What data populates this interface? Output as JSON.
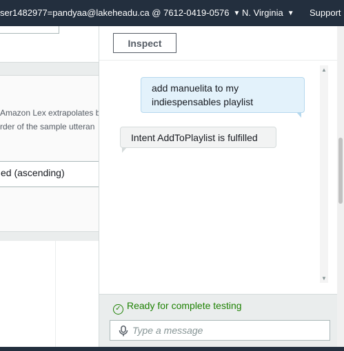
{
  "nav": {
    "account": "ser1482977=pandyaa@lakeheadu.ca @ 7612-0419-0576",
    "region": "N. Virginia",
    "support": "Support"
  },
  "background": {
    "description_line1": "Amazon Lex extrapolates b",
    "description_line2": "rder of the sample utteran",
    "sort_value": "ed (ascending)"
  },
  "test_panel": {
    "inspect_label": "Inspect",
    "messages": [
      {
        "from": "user",
        "text": "add manuelita to my indiespensables playlist"
      },
      {
        "from": "bot",
        "text": "Intent AddToPlaylist is fulfilled"
      }
    ],
    "status": "Ready for complete testing",
    "input_placeholder": "Type a message"
  },
  "colors": {
    "nav_bg": "#232f3e",
    "status_green": "#1d8102",
    "user_bubble": "#e3f2fb",
    "bot_bubble": "#f2f3f3"
  }
}
